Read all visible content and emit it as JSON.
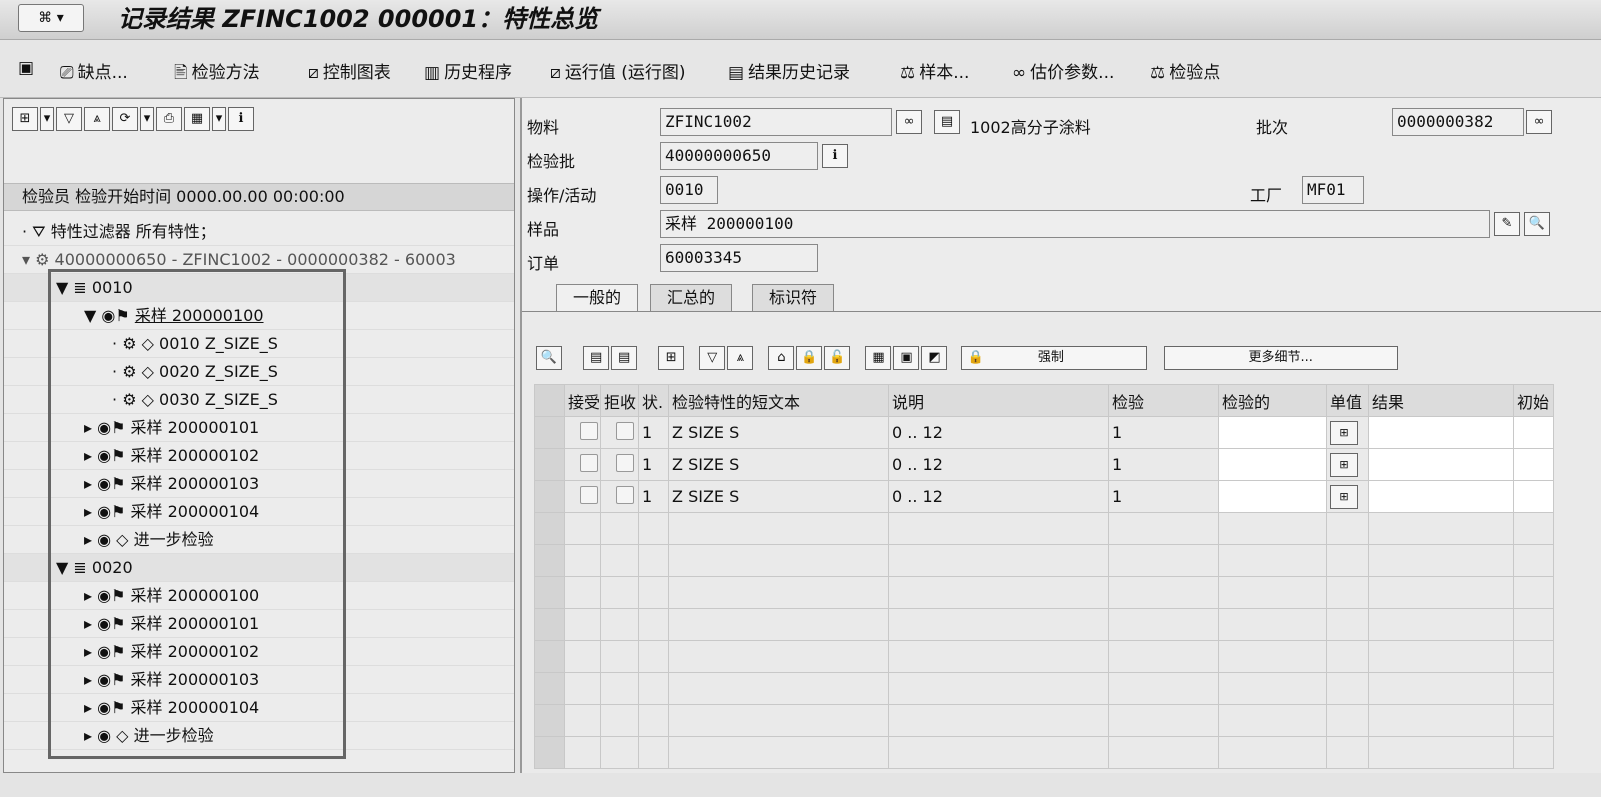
{
  "title": "记录结果 ZFINC1002 000001：特性总览",
  "toolbar": [
    {
      "icon": "⎚",
      "label": "缺点..."
    },
    {
      "icon": "🖹",
      "label": "检验方法"
    },
    {
      "icon": "⧄",
      "label": "控制图表"
    },
    {
      "icon": "▥",
      "label": "历史程序"
    },
    {
      "icon": "⧄",
      "label": "运行值 (运行图)"
    },
    {
      "icon": "▤",
      "label": "结果历史记录"
    },
    {
      "icon": "⚖",
      "label": "样本..."
    },
    {
      "icon": "∞",
      "label": "估价参数..."
    },
    {
      "icon": "⚖",
      "label": "检验点"
    }
  ],
  "left": {
    "header": "检验员 检验开始时间 0000.00.00 00:00:00",
    "filter": "特性过滤器 所有特性；",
    "lot_node": "40000000650 - ZFINC1002 - 0000000382 - 60003",
    "nodes": [
      {
        "indent": 1,
        "exp": "▼",
        "icon": "≣",
        "text": "0010"
      },
      {
        "indent": 2,
        "exp": "▼",
        "icon": "◉⚑",
        "text": "采样 200000100",
        "u": true
      },
      {
        "indent": 3,
        "exp": "·",
        "icon": "⚙ ◇",
        "text": "0010 Z_SIZE_S"
      },
      {
        "indent": 3,
        "exp": "·",
        "icon": "⚙ ◇",
        "text": "0020 Z_SIZE_S"
      },
      {
        "indent": 3,
        "exp": "·",
        "icon": "⚙ ◇",
        "text": "0030 Z_SIZE_S"
      },
      {
        "indent": 2,
        "exp": "▸",
        "icon": "◉⚑",
        "text": "采样 200000101"
      },
      {
        "indent": 2,
        "exp": "▸",
        "icon": "◉⚑",
        "text": "采样 200000102"
      },
      {
        "indent": 2,
        "exp": "▸",
        "icon": "◉⚑",
        "text": "采样 200000103"
      },
      {
        "indent": 2,
        "exp": "▸",
        "icon": "◉⚑",
        "text": "采样 200000104"
      },
      {
        "indent": 2,
        "exp": "▸",
        "icon": "◉ ◇",
        "text": "进一步检验"
      },
      {
        "indent": 1,
        "exp": "▼",
        "icon": "≣",
        "text": "0020"
      },
      {
        "indent": 2,
        "exp": "▸",
        "icon": "◉⚑",
        "text": "采样 200000100"
      },
      {
        "indent": 2,
        "exp": "▸",
        "icon": "◉⚑",
        "text": "采样 200000101"
      },
      {
        "indent": 2,
        "exp": "▸",
        "icon": "◉⚑",
        "text": "采样 200000102"
      },
      {
        "indent": 2,
        "exp": "▸",
        "icon": "◉⚑",
        "text": "采样 200000103"
      },
      {
        "indent": 2,
        "exp": "▸",
        "icon": "◉⚑",
        "text": "采样 200000104"
      },
      {
        "indent": 2,
        "exp": "▸",
        "icon": "◉ ◇",
        "text": "进一步检验"
      }
    ]
  },
  "form": {
    "material_label": "物料",
    "material": "ZFINC1002",
    "material_desc": "1002高分子涂料",
    "batch_label": "批次",
    "batch": "0000000382",
    "lot_label": "检验批",
    "lot": "40000000650",
    "op_label": "操作/活动",
    "op": "0010",
    "plant_label": "工厂",
    "plant": "MF01",
    "sample_label": "样品",
    "sample": "采样 200000100",
    "order_label": "订单",
    "order": "60003345"
  },
  "tabs": [
    "一般的",
    "汇总的",
    "标识符"
  ],
  "grid_buttons": {
    "force": "强制",
    "more": "更多细节..."
  },
  "table": {
    "headers": [
      "接受",
      "拒收",
      "状.",
      "检验特性的短文本",
      "说明",
      "检验",
      "检验的",
      "单值",
      "结果",
      "初始"
    ],
    "rows": [
      {
        "status": "1",
        "text": "Z SIZE S",
        "desc": "0 .. 12",
        "insp": "1"
      },
      {
        "status": "1",
        "text": "Z SIZE S",
        "desc": "0 .. 12",
        "insp": "1"
      },
      {
        "status": "1",
        "text": "Z SIZE S",
        "desc": "0 .. 12",
        "insp": "1"
      }
    ]
  }
}
